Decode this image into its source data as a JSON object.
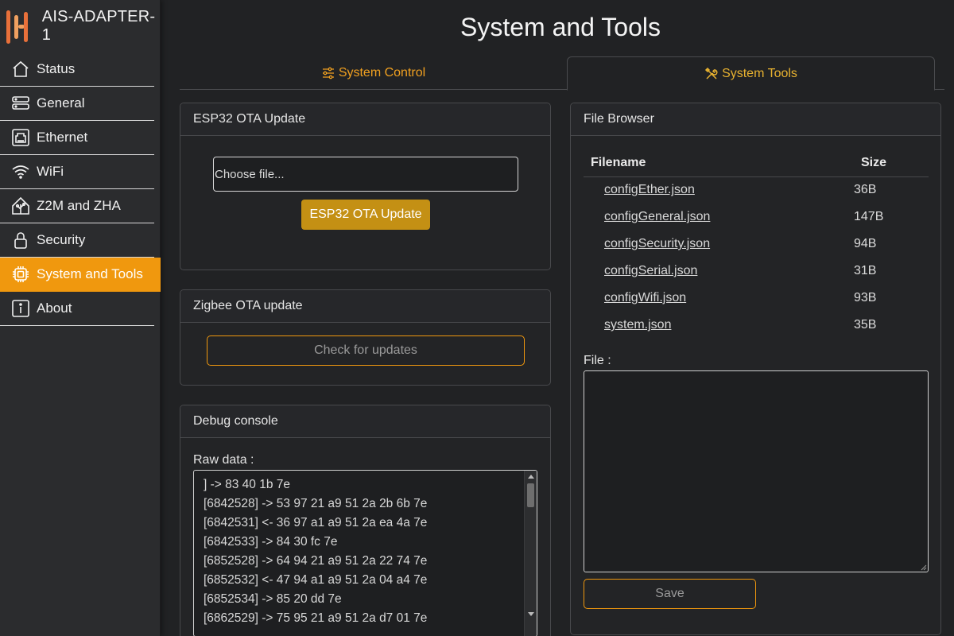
{
  "app": {
    "title": "AIS-ADAPTER-1"
  },
  "sidebar": {
    "items": [
      {
        "label": "Status",
        "icon": "home-icon",
        "active": false
      },
      {
        "label": "General",
        "icon": "server-icon",
        "active": false
      },
      {
        "label": "Ethernet",
        "icon": "ethernet-icon",
        "active": false
      },
      {
        "label": "WiFi",
        "icon": "wifi-icon",
        "active": false
      },
      {
        "label": "Z2M and ZHA",
        "icon": "home-assistant-icon",
        "active": false
      },
      {
        "label": "Security",
        "icon": "lock-icon",
        "active": false
      },
      {
        "label": "System and Tools",
        "icon": "chip-icon",
        "active": true
      },
      {
        "label": "About",
        "icon": "info-icon",
        "active": false
      }
    ]
  },
  "page": {
    "title": "System and Tools"
  },
  "tabs": [
    {
      "label": "System Control",
      "icon": "sliders-icon",
      "active": false
    },
    {
      "label": "System Tools",
      "icon": "tools-icon",
      "active": true
    }
  ],
  "ota": {
    "header": "ESP32 OTA Update",
    "file_placeholder": "Choose file...",
    "button": "ESP32 OTA Update"
  },
  "zigbee": {
    "header": "Zigbee OTA update",
    "button": "Check for updates"
  },
  "debug": {
    "header": "Debug console",
    "raw_label": "Raw data :",
    "lines": [
      "] -> 83 40 1b 7e",
      "[6842528] -> 53 97 21 a9 51 2a 2b 6b 7e",
      "[6842531] <- 36 97 a1 a9 51 2a ea 4a 7e",
      "[6842533] -> 84 30 fc 7e",
      "[6852528] -> 64 94 21 a9 51 2a 22 74 7e",
      "[6852532] <- 47 94 a1 a9 51 2a 04 a4 7e",
      "[6852534] -> 85 20 dd 7e",
      "[6862529] -> 75 95 21 a9 51 2a d7 01 7e"
    ]
  },
  "files": {
    "header": "File Browser",
    "col_name": "Filename",
    "col_size": "Size",
    "rows": [
      {
        "name": "configEther.json",
        "size": "36B"
      },
      {
        "name": "configGeneral.json",
        "size": "147B"
      },
      {
        "name": "configSecurity.json",
        "size": "94B"
      },
      {
        "name": "configSerial.json",
        "size": "31B"
      },
      {
        "name": "configWifi.json",
        "size": "93B"
      },
      {
        "name": "system.json",
        "size": "35B"
      }
    ],
    "file_label": "File :",
    "save_button": "Save"
  },
  "colors": {
    "accent": "#f0980e",
    "ota_button": "#c49014",
    "background": "#212224",
    "sidebar": "#2b2c2e"
  }
}
